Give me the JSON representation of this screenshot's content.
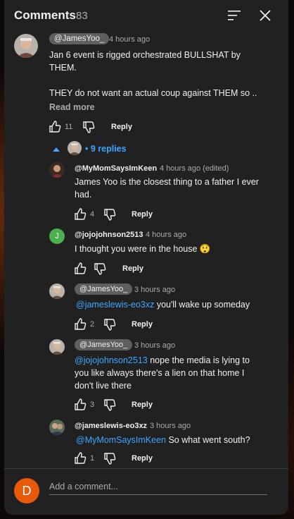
{
  "header": {
    "title": "Comments",
    "count": "83"
  },
  "top_comment": {
    "author": "@JamesYoo_",
    "time": "4 hours ago",
    "text": "Jan 6 event is rigged orchestrated BULLSHAT by THEM.",
    "text2": "THEY do not want an actual coup against THEM so ..",
    "read_more": "Read more",
    "likes": "11",
    "reply_label": "Reply"
  },
  "replies_toggle": {
    "label": "• 9 replies"
  },
  "replies": [
    {
      "author": "@MyMomSaysImKeen",
      "time": "4 hours ago (edited)",
      "mention": "",
      "text": "James Yoo is the closest thing to a father I ever had.",
      "likes": "4",
      "reply_label": "Reply"
    },
    {
      "author": "@jojojohnson2513",
      "avatar_letter": "J",
      "time": "4 hours ago",
      "mention": "",
      "text": "I thought you were in the house 😲",
      "likes": "",
      "reply_label": "Reply"
    },
    {
      "author": "@JamesYoo_",
      "time": "3 hours ago",
      "mention": "@jameslewis-eo3xz",
      "text": " you'll wake up someday",
      "likes": "2",
      "reply_label": "Reply"
    },
    {
      "author": "@JamesYoo_",
      "time": "3 hours ago",
      "mention": "@jojojohnson2513",
      "text": " nope the media is lying to you like always there's a lien on that home I don't live there",
      "likes": "3",
      "reply_label": "Reply"
    },
    {
      "author": "@jameslewis-eo3xz",
      "time": "3 hours ago",
      "mention": "@MyMomSaysImKeen",
      "text": "  So what went south?",
      "likes": "1",
      "reply_label": "Reply"
    }
  ],
  "composer": {
    "avatar_letter": "D",
    "placeholder": "Add a comment..."
  },
  "colors": {
    "panel": "#212121",
    "link": "#3ea6ff",
    "chip": "#5f5f5f",
    "composer_avatar": "#e8590c",
    "j_avatar": "#4caf50"
  }
}
